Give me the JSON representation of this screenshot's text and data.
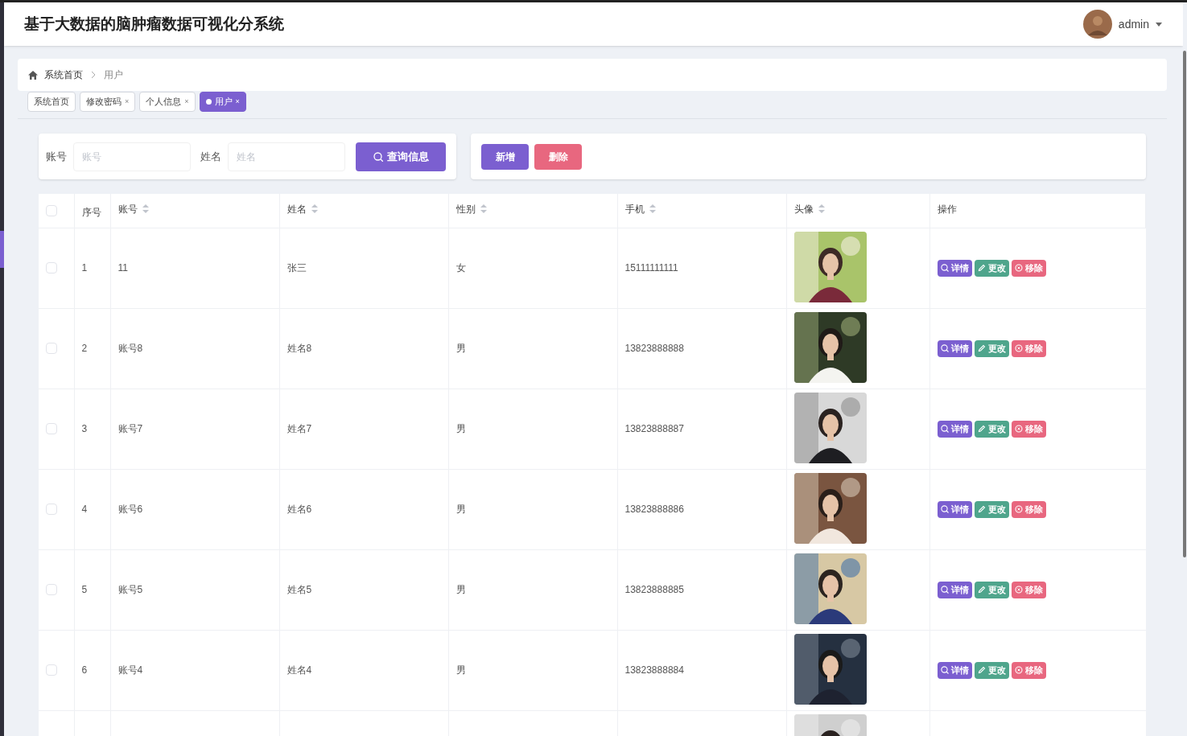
{
  "header": {
    "title": "基于大数据的脑肿瘤数据可视化分系统",
    "user": "admin"
  },
  "breadcrumb": [
    "系统首页",
    "用户"
  ],
  "tabs": [
    {
      "label": "系统首页",
      "selected": false
    },
    {
      "label": "修改密码",
      "selected": false,
      "close": "×"
    },
    {
      "label": "个人信息",
      "selected": false,
      "close": "×"
    },
    {
      "label": "用户",
      "selected": true,
      "close": "×"
    }
  ],
  "search": {
    "fields": [
      {
        "label": "账号",
        "placeholder": "账号"
      },
      {
        "label": "姓名",
        "placeholder": "姓名"
      }
    ],
    "button": "查询信息"
  },
  "actions": [
    {
      "label": "新增",
      "kind": "add"
    },
    {
      "label": "删除",
      "kind": "delete"
    }
  ],
  "table": {
    "header_checked": false,
    "columns": [
      {
        "label": "序号",
        "sortable": false
      },
      {
        "label": "账号",
        "sortable": true
      },
      {
        "label": "姓名",
        "sortable": true
      },
      {
        "label": "性别",
        "sortable": true
      },
      {
        "label": "手机",
        "sortable": true
      },
      {
        "label": "头像",
        "sortable": true
      },
      {
        "label": "操作",
        "sortable": false
      }
    ],
    "rows": [
      {
        "checked": false,
        "cells": [
          "1",
          "11",
          "张三",
          "女",
          "15111111111"
        ],
        "photo": {
          "kind": "picture"
        },
        "buttons": [
          {
            "label": "详情",
            "kind": "detail"
          },
          {
            "label": "更改",
            "kind": "edit"
          },
          {
            "label": "移除",
            "kind": "remove"
          }
        ]
      },
      {
        "checked": false,
        "cells": [
          "2",
          "账号8",
          "姓名8",
          "男",
          "13823888888"
        ],
        "photo": {
          "kind": "picture"
        },
        "buttons": [
          {
            "label": "详情",
            "kind": "detail"
          },
          {
            "label": "更改",
            "kind": "edit"
          },
          {
            "label": "移除",
            "kind": "remove"
          }
        ]
      },
      {
        "checked": false,
        "cells": [
          "3",
          "账号7",
          "姓名7",
          "男",
          "13823888887"
        ],
        "photo": {
          "kind": "picture"
        },
        "buttons": [
          {
            "label": "详情",
            "kind": "detail"
          },
          {
            "label": "更改",
            "kind": "edit"
          },
          {
            "label": "移除",
            "kind": "remove"
          }
        ]
      },
      {
        "checked": false,
        "cells": [
          "4",
          "账号6",
          "姓名6",
          "男",
          "13823888886"
        ],
        "photo": {
          "kind": "picture"
        },
        "buttons": [
          {
            "label": "详情",
            "kind": "detail"
          },
          {
            "label": "更改",
            "kind": "edit"
          },
          {
            "label": "移除",
            "kind": "remove"
          }
        ]
      },
      {
        "checked": false,
        "cells": [
          "5",
          "账号5",
          "姓名5",
          "男",
          "13823888885"
        ],
        "photo": {
          "kind": "picture"
        },
        "buttons": [
          {
            "label": "详情",
            "kind": "detail"
          },
          {
            "label": "更改",
            "kind": "edit"
          },
          {
            "label": "移除",
            "kind": "remove"
          }
        ]
      },
      {
        "checked": false,
        "cells": [
          "6",
          "账号4",
          "姓名4",
          "男",
          "13823888884"
        ],
        "photo": {
          "kind": "picture"
        },
        "buttons": [
          {
            "label": "详情",
            "kind": "detail"
          },
          {
            "label": "更改",
            "kind": "edit"
          },
          {
            "label": "移除",
            "kind": "remove"
          }
        ]
      },
      {
        "photo": {
          "kind": "picture"
        }
      }
    ]
  }
}
